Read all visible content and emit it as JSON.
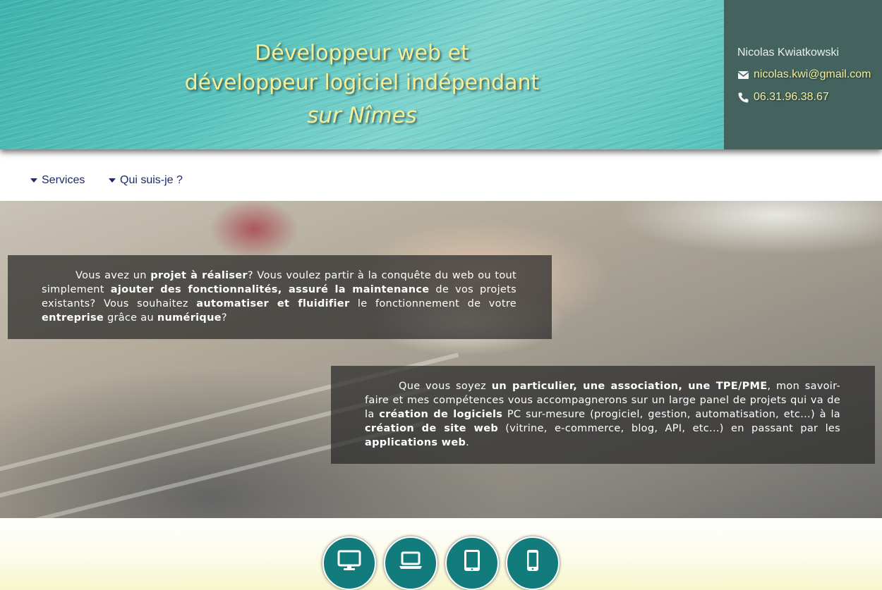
{
  "header": {
    "title_line1": "Développeur web et",
    "title_line2": "développeur logiciel indépendant",
    "title_line3": "sur Nîmes",
    "contact": {
      "name": "Nicolas Kwiatkowski",
      "email": "nicolas.kwi@gmail.com",
      "email_icon": "envelope-icon",
      "phone": "06.31.96.38.67",
      "phone_icon": "phone-icon"
    }
  },
  "nav": {
    "items": [
      {
        "label": "Services",
        "icon": "caret-down-icon"
      },
      {
        "label": "Qui suis-je ?",
        "icon": "caret-down-icon"
      }
    ]
  },
  "hero": {
    "box1": [
      {
        "text": "Vous avez un ",
        "bold": false
      },
      {
        "text": "projet à réaliser",
        "bold": true
      },
      {
        "text": "? Vous voulez partir à la conquête du web ou tout simplement ",
        "bold": false
      },
      {
        "text": "ajouter des fonctionnalités, assuré la maintenance",
        "bold": true
      },
      {
        "text": " de vos projets existants? Vous souhaitez ",
        "bold": false
      },
      {
        "text": "automatiser et fluidifier",
        "bold": true
      },
      {
        "text": " le fonctionnement de votre ",
        "bold": false
      },
      {
        "text": "entreprise",
        "bold": true
      },
      {
        "text": " grâce au ",
        "bold": false
      },
      {
        "text": "numérique",
        "bold": true
      },
      {
        "text": "?",
        "bold": false
      }
    ],
    "box2": [
      {
        "text": "Que vous soyez ",
        "bold": false
      },
      {
        "text": "un particulier, une association, une TPE/PME",
        "bold": true
      },
      {
        "text": ", mon savoir-faire et mes compétences vous accompagnerons sur un large panel de projets qui va de la ",
        "bold": false
      },
      {
        "text": "création de logiciels",
        "bold": true
      },
      {
        "text": " PC sur-mesure (progiciel, gestion, automatisation, etc...) à la ",
        "bold": false
      },
      {
        "text": "création de site web",
        "bold": true
      },
      {
        "text": " (vitrine, e-commerce, blog, API, etc...) en passant par les ",
        "bold": false
      },
      {
        "text": "applications web",
        "bold": true
      },
      {
        "text": ".",
        "bold": false
      }
    ]
  },
  "devices": [
    {
      "icon": "desktop-icon"
    },
    {
      "icon": "laptop-icon"
    },
    {
      "icon": "tablet-icon"
    },
    {
      "icon": "smartphone-icon"
    }
  ],
  "colors": {
    "title_yellow": "#f3ee9a",
    "contact_panel": "#44635f",
    "nav_text": "#1a2a6e",
    "device_button": "#127b7b"
  }
}
